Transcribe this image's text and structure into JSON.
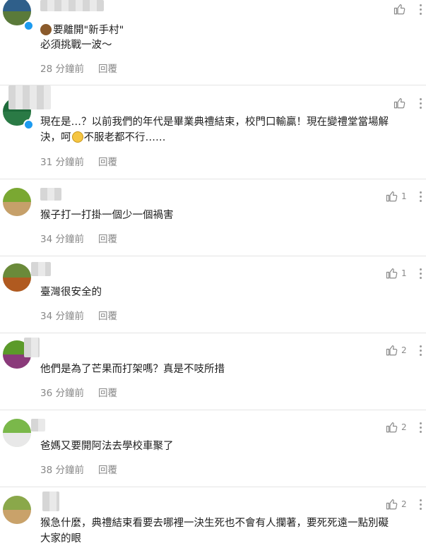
{
  "comments": [
    {
      "line1": "要離開\"新手村\"",
      "line2": "必須挑戰一波～",
      "time": "28 分鐘前",
      "reply": "回覆",
      "likes": "",
      "avatar_top": "#2f5f8a",
      "avatar_bottom": "#5a7a3a"
    },
    {
      "line1": "現在是…？以前我們的年代是畢業典禮結束，校門口輸贏！現在變禮堂當場解",
      "line2_pre": "決，呵",
      "line2_post": "不服老都不行……",
      "time": "31 分鐘前",
      "reply": "回覆",
      "likes": "",
      "avatar_top": "#1e6b3a",
      "avatar_bottom": "#2a7a45"
    },
    {
      "line1": "猴子打一打掛一個少一個禍害",
      "time": "34 分鐘前",
      "reply": "回覆",
      "likes": "1",
      "avatar_top": "#7aa832",
      "avatar_bottom": "#c6a06a"
    },
    {
      "line1": "臺灣很安全的",
      "time": "34 分鐘前",
      "reply": "回覆",
      "likes": "1",
      "avatar_top": "#6a8a3a",
      "avatar_bottom": "#b05a20"
    },
    {
      "line1": "他們是為了芒果而打架嗎？真是不吱所措",
      "time": "36 分鐘前",
      "reply": "回覆",
      "likes": "2",
      "avatar_top": "#5b9a2a",
      "avatar_bottom": "#8a3a7a"
    },
    {
      "line1": "爸媽又要開阿法去學校車聚了",
      "time": "38 分鐘前",
      "reply": "回覆",
      "likes": "2",
      "avatar_top": "#7ab84a",
      "avatar_bottom": "#e8e8e8"
    },
    {
      "line1": "猴急什麼，典禮結束看要去哪裡一決生死也不會有人攔著，要死死遠一點別礙",
      "line2": "大家的眼",
      "time": "",
      "reply": "",
      "likes": "2",
      "avatar_top": "#8aa84a",
      "avatar_bottom": "#c9a26a"
    }
  ]
}
